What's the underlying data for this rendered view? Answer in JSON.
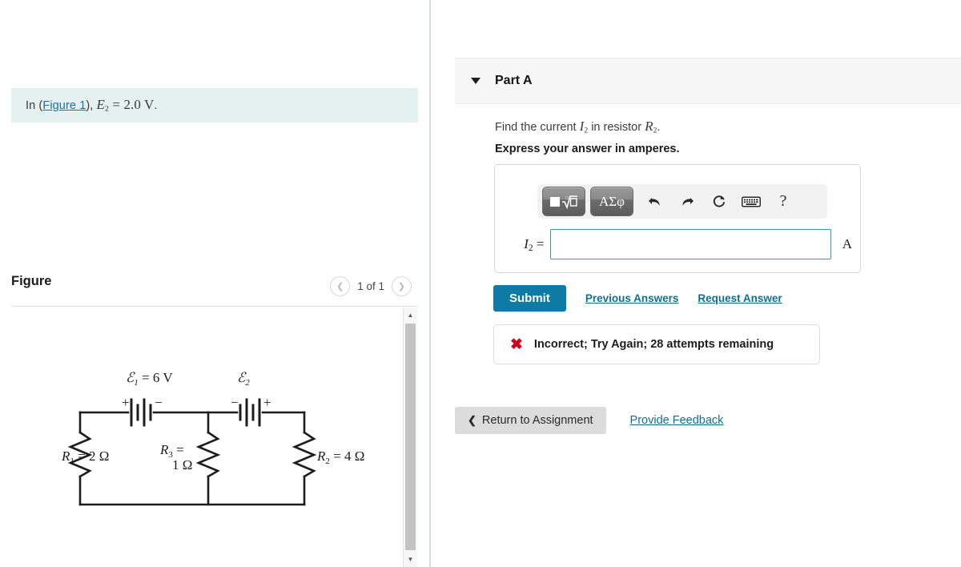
{
  "left": {
    "info": {
      "prefix": "In (",
      "link": "Figure 1",
      "middle": "), ",
      "symbol": "E",
      "symbol_sub": "2",
      "equation": " = 2.0 V",
      "suffix": ".",
      "background_color": "#e4f1f0",
      "link_color": "#1b6ea8"
    },
    "figure": {
      "title": "Figure",
      "pager_prev_icon": "chevron-left-icon",
      "pager_next_icon": "chevron-right-icon",
      "pager_label": "1 of 1"
    },
    "scrollbar": {
      "up_icon": "triangle-up-icon",
      "down_icon": "triangle-down-icon"
    },
    "circuit": {
      "emf1_label": "ℰ",
      "emf1_sub": "1",
      "emf1_value": " = 6 V",
      "emf2_label": "ℰ",
      "emf2_sub": "2",
      "bat1_left_sign": "+",
      "bat1_right_sign": "−",
      "bat2_left_sign": "−",
      "bat2_right_sign": "+",
      "r1_label": "R",
      "r1_sub": "1",
      "r1_value": " = 2 Ω",
      "r3_label": "R",
      "r3_sub": "3",
      "r3_eq": " =",
      "r3_value": "1 Ω",
      "r2_label": "R",
      "r2_sub": "2",
      "r2_value": " = 4 Ω",
      "stroke_color": "#1d1d1d"
    }
  },
  "right": {
    "part": {
      "caret_icon": "caret-down-icon",
      "title": "Part A",
      "header_background": "#f7f7f7"
    },
    "question": {
      "line1_a": "Find the current ",
      "line1_sym": "I",
      "line1_sub": "2",
      "line1_b": " in resistor ",
      "line1_sym2": "R",
      "line1_sub2": "2",
      "line1_c": ".",
      "line2": "Express your answer in amperes."
    },
    "toolbar": {
      "template_button": "math-template-button",
      "greek_button_label": "ΑΣφ",
      "undo_icon": "undo-icon",
      "redo_icon": "redo-icon",
      "reset_icon": "reset-icon",
      "keyboard_icon": "keyboard-icon",
      "help_label": "?"
    },
    "answer": {
      "label_sym": "I",
      "label_sub": "2",
      "label_eq": " =",
      "value": "",
      "placeholder": "",
      "unit": "A",
      "border_color": "#3b94c0"
    },
    "actions": {
      "submit_label": "Submit",
      "previous_answers_label": "Previous Answers",
      "request_answer_label": "Request Answer",
      "submit_color": "#0d7ba3",
      "link_color": "#0f6f96"
    },
    "feedback": {
      "icon": "x-mark-icon",
      "icon_glyph": "✖",
      "text": "Incorrect; Try Again; 28 attempts remaining",
      "icon_color": "#d0021b"
    },
    "bottom": {
      "return_chevron": "❮",
      "return_label": "Return to Assignment",
      "provide_feedback_label": "Provide Feedback"
    }
  }
}
